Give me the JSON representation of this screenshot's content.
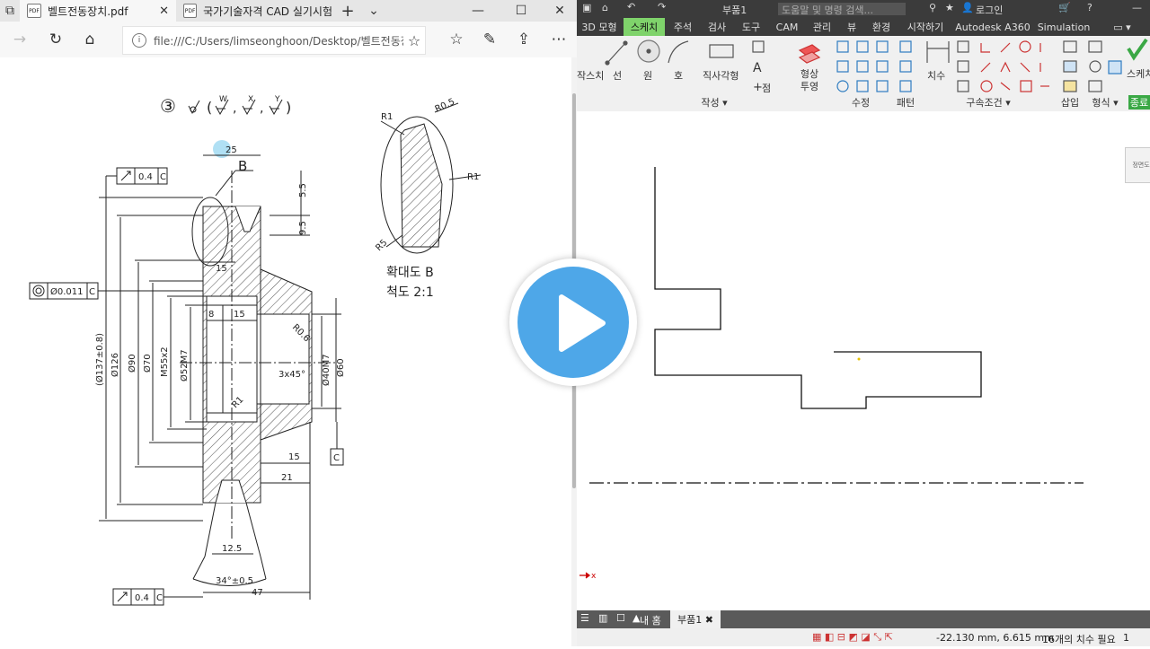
{
  "browser": {
    "tabs": [
      {
        "title": "벨트전동장치.pdf",
        "active": true
      },
      {
        "title": "국가기술자격 CAD 실기시험",
        "active": false
      }
    ],
    "address": "file:///C:/Users/limseonghoon/Desktop/벨트전동장치.p"
  },
  "drawing": {
    "surface_symbol": "③",
    "detail_title": "확대도  B",
    "detail_scale": "척도  2:1",
    "labels": {
      "d25": "25",
      "b": "B",
      "tol04_top": "0.4",
      "c_top": "C",
      "d55": "5.5",
      "d95": "9.5",
      "d15a": "15",
      "circ": "Ø0.011",
      "c_mid": "C",
      "d8": "8",
      "d15b": "15",
      "r06": "R0.6",
      "chamfer": "3x45°",
      "d137": "(Ø137±0.8)",
      "d126": "Ø126",
      "d90": "Ø90",
      "d70": "Ø70",
      "m55": "M55x2",
      "d52": "Ø52M7",
      "d40": "Ø40M7",
      "d60": "Ø60",
      "r1": "R1",
      "d15c": "15",
      "d21": "21",
      "c_box": "C",
      "d125": "12.5",
      "ang": "34°±0.5",
      "d47": "47",
      "tol04_bot": "0.4",
      "c_bot": "C",
      "r1a": "R1",
      "r05": "R0.5",
      "r1b": "R1",
      "r5": "R5"
    }
  },
  "inventor": {
    "title": "부품1",
    "search_placeholder": "도움말 및 명령 검색...",
    "login": "로그인",
    "ribbon_tabs": [
      {
        "label": "3D 모형",
        "active": false
      },
      {
        "label": "스케치",
        "active": true
      },
      {
        "label": "주석",
        "active": false
      },
      {
        "label": "검사",
        "active": false
      },
      {
        "label": "도구",
        "active": false
      },
      {
        "label": "CAM",
        "active": false
      },
      {
        "label": "관리",
        "active": false
      },
      {
        "label": "뷰",
        "active": false
      },
      {
        "label": "환경",
        "active": false
      },
      {
        "label": "시작하기",
        "active": false
      },
      {
        "label": "Autodesk A360",
        "active": false
      },
      {
        "label": "Simulation",
        "active": false
      }
    ],
    "tools": {
      "start": "작스치",
      "line": "선",
      "circle": "원",
      "arc": "호",
      "rect": "직사각형",
      "project": "형상 투영",
      "point": "점",
      "dimension": "치수",
      "finish": "스케치 마무리"
    },
    "groups": {
      "create": "작성",
      "modify": "수정",
      "pattern": "패턴",
      "constrain": "구속조건",
      "insert": "삽입",
      "format": "형식",
      "exit": "종료"
    },
    "side_button": "정면도",
    "bottom_tabs": {
      "home": "내 홈",
      "doc": "부품1"
    },
    "status": {
      "coords": "-22.130 mm, 6.615 mm",
      "dims": "16개의 치수 필요",
      "count": "1"
    }
  }
}
